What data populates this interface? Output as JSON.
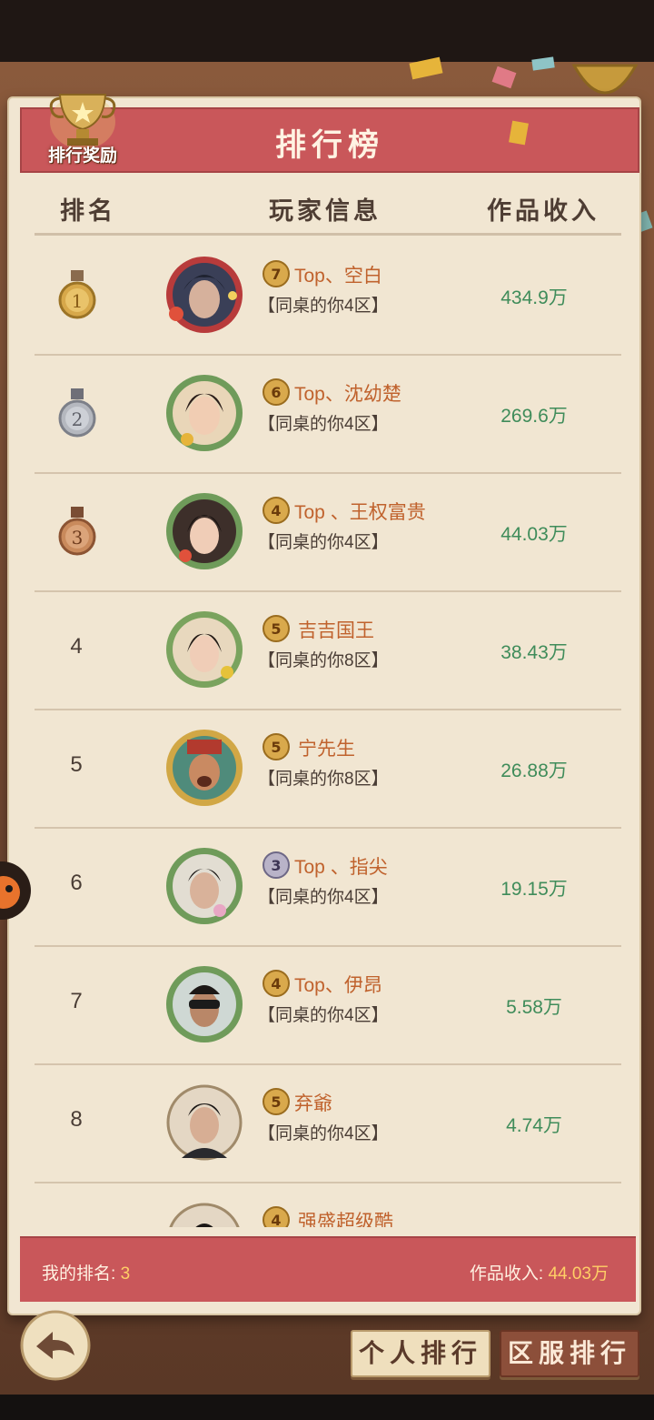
{
  "title": "排行榜",
  "reward_label": "排行奖励",
  "headers": {
    "rank": "排名",
    "player": "玩家信息",
    "income": "作品收入"
  },
  "rows": [
    {
      "rank": "1",
      "vip": "7",
      "name": "Top、空白",
      "server": "【同桌的你4区】",
      "income": "434.9万"
    },
    {
      "rank": "2",
      "vip": "6",
      "name": "Top、沈幼楚",
      "server": "【同桌的你4区】",
      "income": "269.6万"
    },
    {
      "rank": "3",
      "vip": "4",
      "name": "Top 、王权富贵",
      "server": "【同桌的你4区】",
      "income": "44.03万"
    },
    {
      "rank": "4",
      "vip": "5",
      "name": "吉吉国王",
      "server": "【同桌的你8区】",
      "income": "38.43万"
    },
    {
      "rank": "5",
      "vip": "5",
      "name": "宁先生",
      "server": "【同桌的你8区】",
      "income": "26.88万"
    },
    {
      "rank": "6",
      "vip": "3",
      "name": "Top 、指尖",
      "server": "【同桌的你4区】",
      "income": "19.15万"
    },
    {
      "rank": "7",
      "vip": "4",
      "name": "Top、伊昂",
      "server": "【同桌的你4区】",
      "income": "5.58万"
    },
    {
      "rank": "8",
      "vip": "5",
      "name": "弃爺",
      "server": "【同桌的你4区】",
      "income": "4.74万"
    },
    {
      "rank": "",
      "vip": "4",
      "name": "强盛超级酷",
      "server": "",
      "income": ""
    }
  ],
  "footer": {
    "my_rank_label": "我的排名: ",
    "my_rank_value": "3",
    "income_label": "作品收入: ",
    "income_value": "44.03万"
  },
  "buttons": {
    "personal": "个人排行",
    "server": "区服排行"
  },
  "colors": {
    "accent_red": "#c9575a",
    "panel": "#f1e6d2",
    "income_green": "#3f8c5a",
    "name_orange": "#c0622d",
    "gold": "#ffcf66"
  },
  "icons": {
    "back": "back-arrow-icon",
    "trophy": "trophy-icon",
    "medals": [
      "gold-medal-icon",
      "silver-medal-icon",
      "bronze-medal-icon"
    ]
  }
}
